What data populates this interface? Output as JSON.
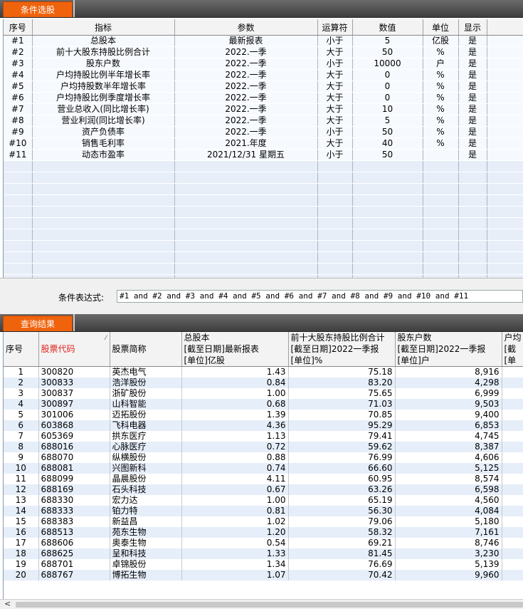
{
  "tabs": {
    "conditions": "条件选股",
    "results": "查询结果"
  },
  "conditions": {
    "headers": [
      "序号",
      "指标",
      "参数",
      "运算符",
      "数值",
      "单位",
      "显示"
    ],
    "rows": [
      [
        "#1",
        "总股本",
        "最新报表",
        "小于",
        "5",
        "亿股",
        "是"
      ],
      [
        "#2",
        "前十大股东持股比例合计",
        "2022.一季",
        "大于",
        "50",
        "%",
        "是"
      ],
      [
        "#3",
        "股东户数",
        "2022.一季",
        "小于",
        "10000",
        "户",
        "是"
      ],
      [
        "#4",
        "户均持股比例半年增长率",
        "2022.一季",
        "大于",
        "0",
        "%",
        "是"
      ],
      [
        "#5",
        "户均持股数半年增长率",
        "2022.一季",
        "大于",
        "0",
        "%",
        "是"
      ],
      [
        "#6",
        "户均持股比例季度增长率",
        "2022.一季",
        "大于",
        "0",
        "%",
        "是"
      ],
      [
        "#7",
        "营业总收入(同比增长率)",
        "2022.一季",
        "大于",
        "10",
        "%",
        "是"
      ],
      [
        "#8",
        "营业利润(同比增长率)",
        "2022.一季",
        "大于",
        "5",
        "%",
        "是"
      ],
      [
        "#9",
        "资产负债率",
        "2022.一季",
        "小于",
        "50",
        "%",
        "是"
      ],
      [
        "#10",
        "销售毛利率",
        "2021.年度",
        "大于",
        "40",
        "%",
        "是"
      ],
      [
        "#11",
        "动态市盈率",
        "2021/12/31 星期五",
        "小于",
        "50",
        "",
        "是"
      ]
    ],
    "expression_label": "条件表达式:",
    "expression": "#1 and #2 and #3 and #4 and #5 and #6 and #7 and #8 and #9 and #10 and #11"
  },
  "results": {
    "headers": {
      "seq": "序号",
      "code": "股票代码",
      "name": "股票简称",
      "col1": [
        "总股本",
        "[截至日期]最新报表",
        "[单位]亿股"
      ],
      "col2": [
        "前十大股东持股比例合计",
        "[截至日期]2022一季报",
        "[单位]%"
      ],
      "col3": [
        "股东户数",
        "[截至日期]2022一季报",
        "[单位]户"
      ],
      "col4": [
        "户均",
        "[截",
        "[单"
      ]
    },
    "rows": [
      [
        "1",
        "300820",
        "英杰电气",
        "1.43",
        "75.18",
        "8,916"
      ],
      [
        "2",
        "300833",
        "浩洋股份",
        "0.84",
        "83.20",
        "4,298"
      ],
      [
        "3",
        "300837",
        "浙矿股份",
        "1.00",
        "75.65",
        "6,999"
      ],
      [
        "4",
        "300897",
        "山科智能",
        "0.68",
        "71.03",
        "9,503"
      ],
      [
        "5",
        "301006",
        "迈拓股份",
        "1.39",
        "70.85",
        "9,400"
      ],
      [
        "6",
        "603868",
        "飞科电器",
        "4.36",
        "95.29",
        "6,853"
      ],
      [
        "7",
        "605369",
        "拱东医疗",
        "1.13",
        "79.41",
        "4,745"
      ],
      [
        "8",
        "688016",
        "心脉医疗",
        "0.72",
        "59.62",
        "8,387"
      ],
      [
        "9",
        "688070",
        "纵横股份",
        "0.88",
        "76.99",
        "4,606"
      ],
      [
        "10",
        "688081",
        "兴图新科",
        "0.74",
        "66.60",
        "5,125"
      ],
      [
        "11",
        "688099",
        "晶晨股份",
        "4.11",
        "60.95",
        "8,574"
      ],
      [
        "12",
        "688169",
        "石头科技",
        "0.67",
        "63.26",
        "6,598"
      ],
      [
        "13",
        "688330",
        "宏力达",
        "1.00",
        "65.19",
        "4,560"
      ],
      [
        "14",
        "688333",
        "铂力特",
        "0.81",
        "56.30",
        "4,084"
      ],
      [
        "15",
        "688383",
        "新益昌",
        "1.02",
        "79.06",
        "5,180"
      ],
      [
        "16",
        "688513",
        "苑东生物",
        "1.20",
        "58.32",
        "7,161"
      ],
      [
        "17",
        "688606",
        "奥泰生物",
        "0.54",
        "69.21",
        "8,746"
      ],
      [
        "18",
        "688625",
        "呈和科技",
        "1.33",
        "81.45",
        "3,230"
      ],
      [
        "19",
        "688701",
        "卓锦股份",
        "1.34",
        "76.69",
        "5,139"
      ],
      [
        "20",
        "688767",
        "博拓生物",
        "1.07",
        "70.42",
        "9,960"
      ]
    ]
  },
  "colors": {
    "tab": "#f0630d",
    "code_header": "#e0221c",
    "row_alt": "#e6eef9"
  }
}
